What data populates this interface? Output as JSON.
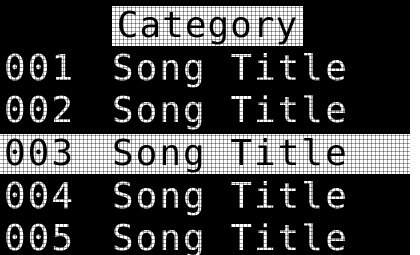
{
  "header": {
    "title": "Category"
  },
  "song_list": {
    "items": [
      {
        "number": "001",
        "title": "Song Title",
        "selected": false
      },
      {
        "number": "002",
        "title": "Song Title",
        "selected": false
      },
      {
        "number": "003",
        "title": "Song Title",
        "selected": true
      },
      {
        "number": "004",
        "title": "Song Title",
        "selected": false
      },
      {
        "number": "005",
        "title": "Song Title",
        "selected": false
      }
    ]
  },
  "colors": {
    "background": "#000000",
    "foreground": "#ffffff",
    "highlight_background": "#ffffff",
    "highlight_foreground": "#000000"
  }
}
